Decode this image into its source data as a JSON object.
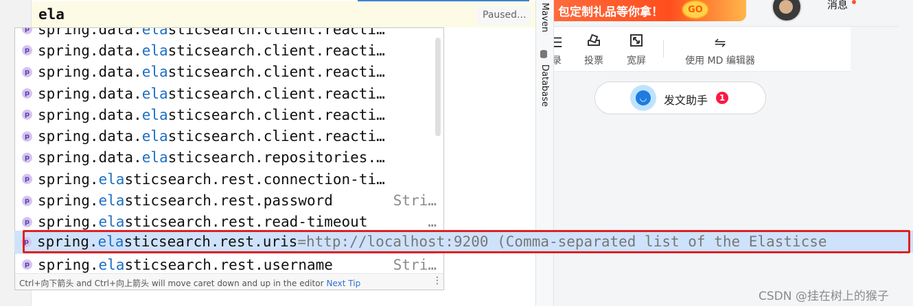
{
  "editor": {
    "typed_text": "ela",
    "status": "Paused..."
  },
  "sidebar_tools": {
    "maven": "Maven",
    "database": "Database"
  },
  "popup": {
    "rows": [
      {
        "prefix": "spring.data.",
        "match": "ela",
        "rest": "sticsearch.client.reacti…",
        "type": ""
      },
      {
        "prefix": "spring.data.",
        "match": "ela",
        "rest": "sticsearch.client.reacti…",
        "type": ""
      },
      {
        "prefix": "spring.data.",
        "match": "ela",
        "rest": "sticsearch.client.reacti…",
        "type": ""
      },
      {
        "prefix": "spring.data.",
        "match": "ela",
        "rest": "sticsearch.client.reacti…",
        "type": ""
      },
      {
        "prefix": "spring.data.",
        "match": "ela",
        "rest": "sticsearch.client.reacti…",
        "type": ""
      },
      {
        "prefix": "spring.data.",
        "match": "ela",
        "rest": "sticsearch.client.reacti…",
        "type": ""
      },
      {
        "prefix": "spring.data.",
        "match": "ela",
        "rest": "sticsearch.repositories.…",
        "type": ""
      },
      {
        "prefix": "spring.",
        "match": "ela",
        "rest": "sticsearch.rest.connection-ti…",
        "type": ""
      },
      {
        "prefix": "spring.",
        "match": "ela",
        "rest": "sticsearch.rest.password",
        "type": "Stri…"
      },
      {
        "prefix": "spring.",
        "match": "ela",
        "rest": "sticsearch.rest.read-timeout",
        "type": "…"
      },
      {
        "prefix": "",
        "match": "",
        "rest": "",
        "type": ""
      },
      {
        "prefix": "spring.",
        "match": "ela",
        "rest": "sticsearch.rest.username",
        "type": "Stri…"
      }
    ],
    "selected": {
      "prefix": "spring.",
      "match": "ela",
      "rest": "sticsearch.rest.uris",
      "description": "=http://localhost:9200 (Comma-separated list of the Elasticse"
    },
    "footer_hint": "Ctrl+向下箭头 and Ctrl+向上箭头 will move caret down and up in the editor",
    "footer_link": "Next Tip",
    "property_badge": "p"
  },
  "web": {
    "banner_text": "包定制礼品等你拿！",
    "banner_go": "GO",
    "messages_label": "消息",
    "toolbar": [
      {
        "label": "录",
        "icon": "directory-icon"
      },
      {
        "label": "投票",
        "icon": "vote-icon"
      },
      {
        "label": "宽屏",
        "icon": "widescreen-icon"
      },
      {
        "label": "使用 MD 编辑器",
        "icon": "switch-editor-icon"
      }
    ],
    "assistant_label": "发文助手",
    "assistant_badge": "1",
    "watermark": "CSDN @挂在树上的猴子"
  }
}
